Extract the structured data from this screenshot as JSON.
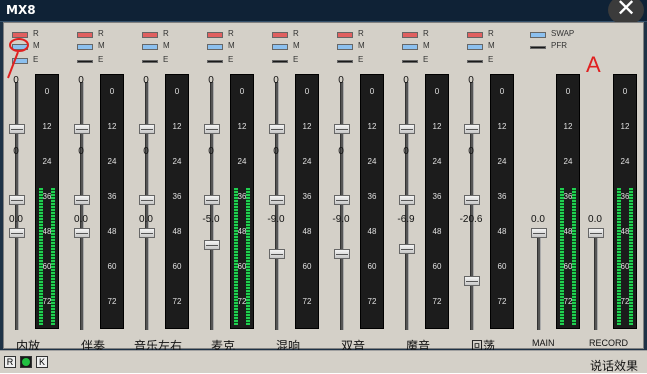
{
  "window": {
    "title": "MX8",
    "close_glyph": "✕"
  },
  "selectors": {
    "r": "R",
    "m": "M",
    "e": "E",
    "swap": "SWAP",
    "pfr": "PFR"
  },
  "meter_ticks": [
    "0",
    "12",
    "24",
    "36",
    "48",
    "60",
    "72"
  ],
  "channels": [
    {
      "name": "内放",
      "val1": "0",
      "val2": "0",
      "val3": "0.0",
      "level": 0.55
    },
    {
      "name": "伴奏",
      "val1": "0",
      "val2": "0",
      "val3": "0.0",
      "level": 0
    },
    {
      "name": "音乐左右",
      "val1": "0",
      "val2": "0",
      "val3": "0.0",
      "level": 0
    },
    {
      "name": "麦克",
      "val1": "0",
      "val2": "0",
      "val3": "-5.0",
      "level": 0.55
    },
    {
      "name": "混响",
      "val1": "0",
      "val2": "0",
      "val3": "-9.0",
      "level": 0
    },
    {
      "name": "双音",
      "val1": "0",
      "val2": "0",
      "val3": "-9.0",
      "level": 0
    },
    {
      "name": "魔音",
      "val1": "0",
      "val2": "0",
      "val3": "-6.9",
      "level": 0
    },
    {
      "name": "回荡",
      "val1": "0",
      "val2": "0",
      "val3": "-20.6",
      "level": 0
    }
  ],
  "outputs": [
    {
      "name": "MAIN",
      "val": "0.0",
      "level": 0.55
    },
    {
      "name": "RECORD",
      "val": "0.0",
      "level": 0.55
    }
  ],
  "annotation": {
    "letter": "A"
  },
  "bottom": {
    "r": "R",
    "g": "",
    "k": "K",
    "effect_label": "说话效果"
  }
}
